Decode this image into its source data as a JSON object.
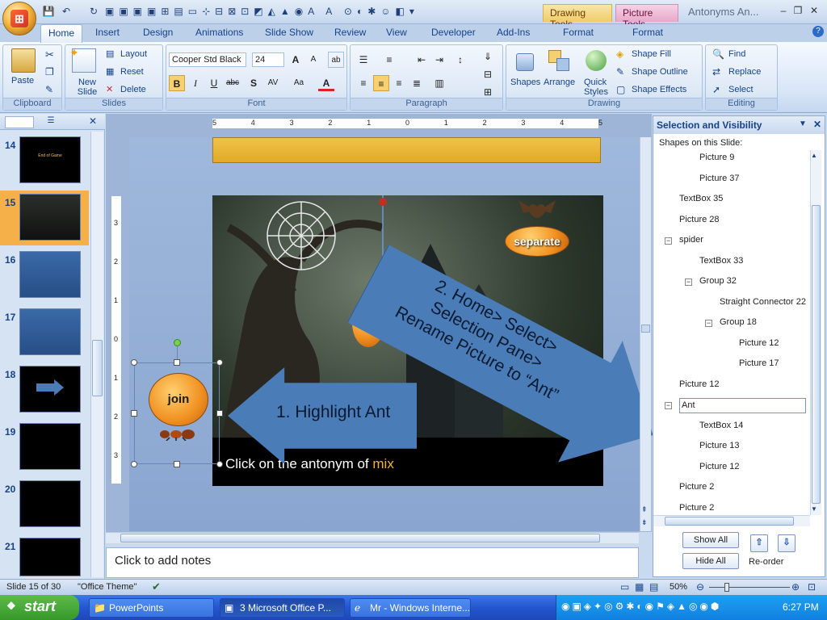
{
  "window": {
    "doc_title": "Antonyms An...",
    "context_tabs": {
      "drawing": "Drawing Tools",
      "picture": "Picture Tools"
    }
  },
  "tabs": [
    "Home",
    "Insert",
    "Design",
    "Animations",
    "Slide Show",
    "Review",
    "View",
    "Developer",
    "Add-Ins",
    "Format",
    "Format"
  ],
  "ribbon": {
    "clipboard": {
      "label": "Clipboard",
      "paste": "Paste"
    },
    "slides": {
      "label": "Slides",
      "new_slide": "New Slide",
      "layout": "Layout",
      "reset": "Reset",
      "delete": "Delete"
    },
    "font": {
      "label": "Font",
      "family": "Cooper Std Black",
      "size": "24"
    },
    "paragraph": {
      "label": "Paragraph"
    },
    "drawing": {
      "label": "Drawing",
      "shapes": "Shapes",
      "arrange": "Arrange",
      "quick_styles": "Quick Styles",
      "shape_fill": "Shape Fill",
      "shape_outline": "Shape Outline",
      "shape_effects": "Shape Effects"
    },
    "editing": {
      "label": "Editing",
      "find": "Find",
      "replace": "Replace",
      "select": "Select"
    }
  },
  "slides_panel": {
    "numbers": [
      "14",
      "15",
      "16",
      "17",
      "18",
      "19",
      "20",
      "21"
    ],
    "thumb14_text": "End of Game"
  },
  "slide": {
    "callout1": "1. Highlight Ant",
    "callout2": [
      "2. Home> Select>",
      "Selection Pane>",
      "Rename Picture to “Ant”"
    ],
    "pumpkin_join": "join",
    "pumpkin_separate": "separate",
    "prompt_prefix": "Click on the antonym of ",
    "prompt_word": "mix",
    "ruler_labels": [
      "5",
      "4",
      "3",
      "2",
      "1",
      "0",
      "1",
      "2",
      "3",
      "4",
      "5"
    ],
    "vruler_labels": [
      "3",
      "2",
      "1",
      "0",
      "1",
      "2",
      "3"
    ]
  },
  "notes": "Click to add notes",
  "selection_pane": {
    "title": "Selection and Visibility",
    "subtitle": "Shapes on this Slide:",
    "items": [
      {
        "label": "Picture 9",
        "level": 2
      },
      {
        "label": "Picture 37",
        "level": 2
      },
      {
        "label": "TextBox 35",
        "level": 1
      },
      {
        "label": "Picture 28",
        "level": 1
      },
      {
        "label": "spider",
        "level": 1,
        "expander": true
      },
      {
        "label": "TextBox 33",
        "level": 2
      },
      {
        "label": "Group 32",
        "level": 2,
        "expander": true
      },
      {
        "label": "Straight Connector 22",
        "level": 3
      },
      {
        "label": "Group 18",
        "level": 3,
        "expander": true
      },
      {
        "label": "Picture 12",
        "level": 4
      },
      {
        "label": "Picture 17",
        "level": 4
      },
      {
        "label": "Picture 12",
        "level": 1
      },
      {
        "label": "Ant",
        "level": 1,
        "expander": true,
        "editing": true
      },
      {
        "label": "TextBox 14",
        "level": 2
      },
      {
        "label": "Picture 13",
        "level": 2
      },
      {
        "label": "Picture 12",
        "level": 2
      },
      {
        "label": "Picture 2",
        "level": 1
      },
      {
        "label": "Picture 2",
        "level": 1
      }
    ],
    "show_all": "Show All",
    "hide_all": "Hide All",
    "reorder": "Re-order"
  },
  "status": {
    "slide": "Slide 15 of 30",
    "theme": "\"Office Theme\"",
    "zoom": "50%"
  },
  "taskbar": {
    "start": "start",
    "tasks": [
      "PowerPoints",
      "3 Microsoft Office P...",
      "Mr - Windows Interne..."
    ],
    "clock": "6:27 PM"
  },
  "colors": {
    "accent": "#15428b",
    "callout": "#4a7cb8",
    "prompt_word": "#f0b43c"
  }
}
